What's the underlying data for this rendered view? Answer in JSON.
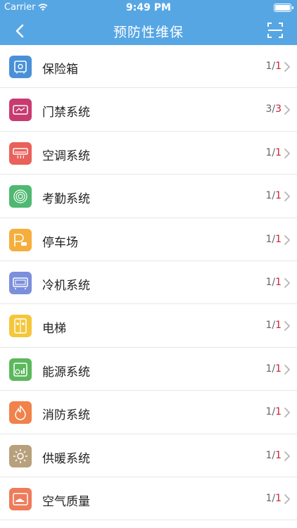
{
  "status_bar": {
    "carrier": "Carrier",
    "time": "9:49 PM"
  },
  "nav": {
    "title": "预防性维保",
    "back_icon": "chevron-left-icon",
    "scan_icon": "scan-frame-icon",
    "bg_color": "#57a6e4"
  },
  "items": [
    {
      "label": "保险箱",
      "done": "1",
      "total": "1",
      "icon": "safe-icon",
      "color": "#4a90d9"
    },
    {
      "label": "门禁系统",
      "done": "3",
      "total": "3",
      "icon": "access-card-icon",
      "color": "#c73b6f"
    },
    {
      "label": "空调系统",
      "done": "1",
      "total": "1",
      "icon": "air-conditioner-icon",
      "color": "#e9615a"
    },
    {
      "label": "考勤系统",
      "done": "1",
      "total": "1",
      "icon": "fingerprint-icon",
      "color": "#4fb871"
    },
    {
      "label": "停车场",
      "done": "1",
      "total": "1",
      "icon": "parking-icon",
      "color": "#f5ae3c"
    },
    {
      "label": "冷机系统",
      "done": "1",
      "total": "1",
      "icon": "chiller-icon",
      "color": "#7b8fdc"
    },
    {
      "label": "电梯",
      "done": "1",
      "total": "1",
      "icon": "elevator-icon",
      "color": "#f4c63a"
    },
    {
      "label": "能源系统",
      "done": "1",
      "total": "1",
      "icon": "energy-meter-icon",
      "color": "#5cb85c"
    },
    {
      "label": "消防系统",
      "done": "1",
      "total": "1",
      "icon": "fire-icon",
      "color": "#f0824a"
    },
    {
      "label": "供暖系统",
      "done": "1",
      "total": "1",
      "icon": "sun-heating-icon",
      "color": "#b8a07c"
    },
    {
      "label": "空气质量",
      "done": "1",
      "total": "1",
      "icon": "air-quality-icon",
      "color": "#ef7b5a"
    }
  ]
}
